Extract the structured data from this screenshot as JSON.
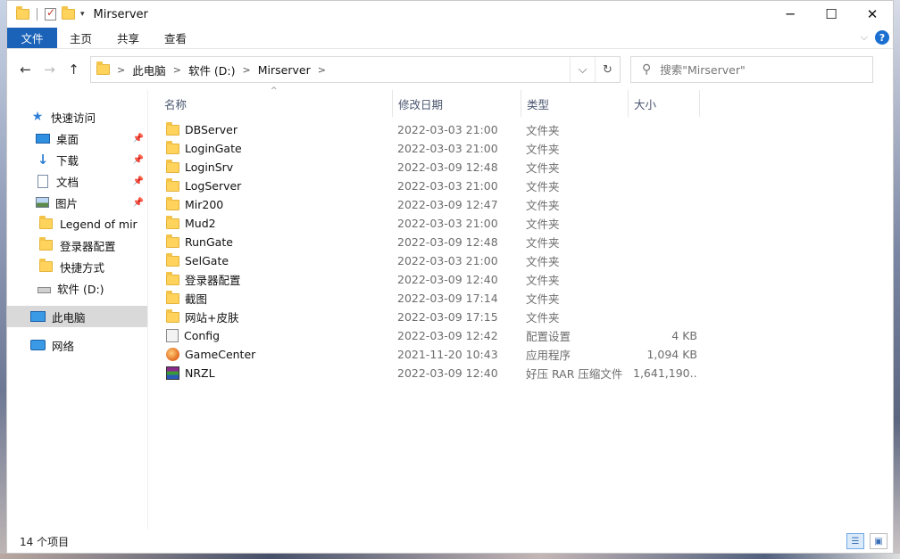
{
  "window": {
    "title": "Mirserver",
    "controls": {
      "minimize": "─",
      "maximize": "☐",
      "close": "✕"
    }
  },
  "ribbon": {
    "tabs": [
      "文件",
      "主页",
      "共享",
      "查看"
    ]
  },
  "nav": {
    "back": "←",
    "forward": "→",
    "up": "↑",
    "breadcrumb": [
      "此电脑",
      "软件 (D:)",
      "Mirserver"
    ],
    "search_placeholder": "搜索\"Mirserver\""
  },
  "sidebar": {
    "quick_access": "快速访问",
    "pinned": [
      {
        "label": "桌面",
        "icon": "desktop-icon"
      },
      {
        "label": "下载",
        "icon": "download-icon"
      },
      {
        "label": "文档",
        "icon": "documents-icon"
      },
      {
        "label": "图片",
        "icon": "pictures-icon"
      }
    ],
    "recent": [
      "Legend of mir",
      "登录器配置",
      "快捷方式"
    ],
    "drive": "软件 (D:)",
    "this_pc": "此电脑",
    "network": "网络"
  },
  "columns": {
    "name": "名称",
    "date": "修改日期",
    "type": "类型",
    "size": "大小"
  },
  "files": [
    {
      "name": "DBServer",
      "date": "2022-03-03 21:00",
      "type": "文件夹",
      "size": "",
      "icon": "folder-icon"
    },
    {
      "name": "LoginGate",
      "date": "2022-03-03 21:00",
      "type": "文件夹",
      "size": "",
      "icon": "folder-icon"
    },
    {
      "name": "LoginSrv",
      "date": "2022-03-09 12:48",
      "type": "文件夹",
      "size": "",
      "icon": "folder-icon"
    },
    {
      "name": "LogServer",
      "date": "2022-03-03 21:00",
      "type": "文件夹",
      "size": "",
      "icon": "folder-icon"
    },
    {
      "name": "Mir200",
      "date": "2022-03-09 12:47",
      "type": "文件夹",
      "size": "",
      "icon": "folder-icon"
    },
    {
      "name": "Mud2",
      "date": "2022-03-03 21:00",
      "type": "文件夹",
      "size": "",
      "icon": "folder-icon"
    },
    {
      "name": "RunGate",
      "date": "2022-03-09 12:48",
      "type": "文件夹",
      "size": "",
      "icon": "folder-icon"
    },
    {
      "name": "SelGate",
      "date": "2022-03-03 21:00",
      "type": "文件夹",
      "size": "",
      "icon": "folder-icon"
    },
    {
      "name": "登录器配置",
      "date": "2022-03-09 12:40",
      "type": "文件夹",
      "size": "",
      "icon": "folder-icon"
    },
    {
      "name": "截图",
      "date": "2022-03-09 17:14",
      "type": "文件夹",
      "size": "",
      "icon": "folder-icon"
    },
    {
      "name": "网站+皮肤",
      "date": "2022-03-09 17:15",
      "type": "文件夹",
      "size": "",
      "icon": "folder-icon"
    },
    {
      "name": "Config",
      "date": "2022-03-09 12:42",
      "type": "配置设置",
      "size": "4 KB",
      "icon": "config-file-icon"
    },
    {
      "name": "GameCenter",
      "date": "2021-11-20 10:43",
      "type": "应用程序",
      "size": "1,094 KB",
      "icon": "app-icon"
    },
    {
      "name": "NRZL",
      "date": "2022-03-09 12:40",
      "type": "好压 RAR 压缩文件",
      "size": "1,641,190...",
      "icon": "rar-archive-icon"
    }
  ],
  "status": {
    "item_count": "14 个项目"
  },
  "colors": {
    "accent": "#1a63b8",
    "folder": "#ffd35c",
    "selection": "#d9d9d9"
  }
}
